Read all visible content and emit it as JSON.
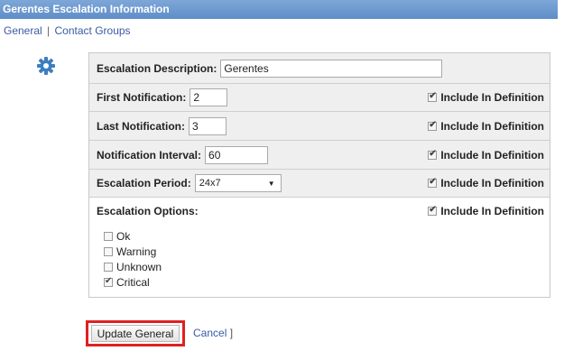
{
  "title": "Gerentes Escalation Information",
  "subnav": {
    "general": "General",
    "separator": "|",
    "contact_groups": "Contact Groups"
  },
  "fields": {
    "description": {
      "label": "Escalation Description:",
      "value": "Gerentes"
    },
    "first_notification": {
      "label": "First Notification:",
      "value": "2",
      "include_label": "Include In Definition",
      "include_checked": true
    },
    "last_notification": {
      "label": "Last Notification:",
      "value": "3",
      "include_label": "Include In Definition",
      "include_checked": true
    },
    "notification_interval": {
      "label": "Notification Interval:",
      "value": "60",
      "include_label": "Include In Definition",
      "include_checked": true
    },
    "escalation_period": {
      "label": "Escalation Period:",
      "value": "24x7",
      "include_label": "Include In Definition",
      "include_checked": true
    },
    "escalation_options": {
      "label": "Escalation Options:",
      "include_label": "Include In Definition",
      "include_checked": true
    }
  },
  "options": [
    {
      "label": "Ok",
      "checked": false
    },
    {
      "label": "Warning",
      "checked": false
    },
    {
      "label": "Unknown",
      "checked": false
    },
    {
      "label": "Critical",
      "checked": true
    }
  ],
  "actions": {
    "update_label": "Update General",
    "cancel_label": "Cancel",
    "close_bracket": "]"
  },
  "colors": {
    "titlebar": "#6a96cf",
    "highlight": "#e02020",
    "link": "#3a5aa5"
  }
}
